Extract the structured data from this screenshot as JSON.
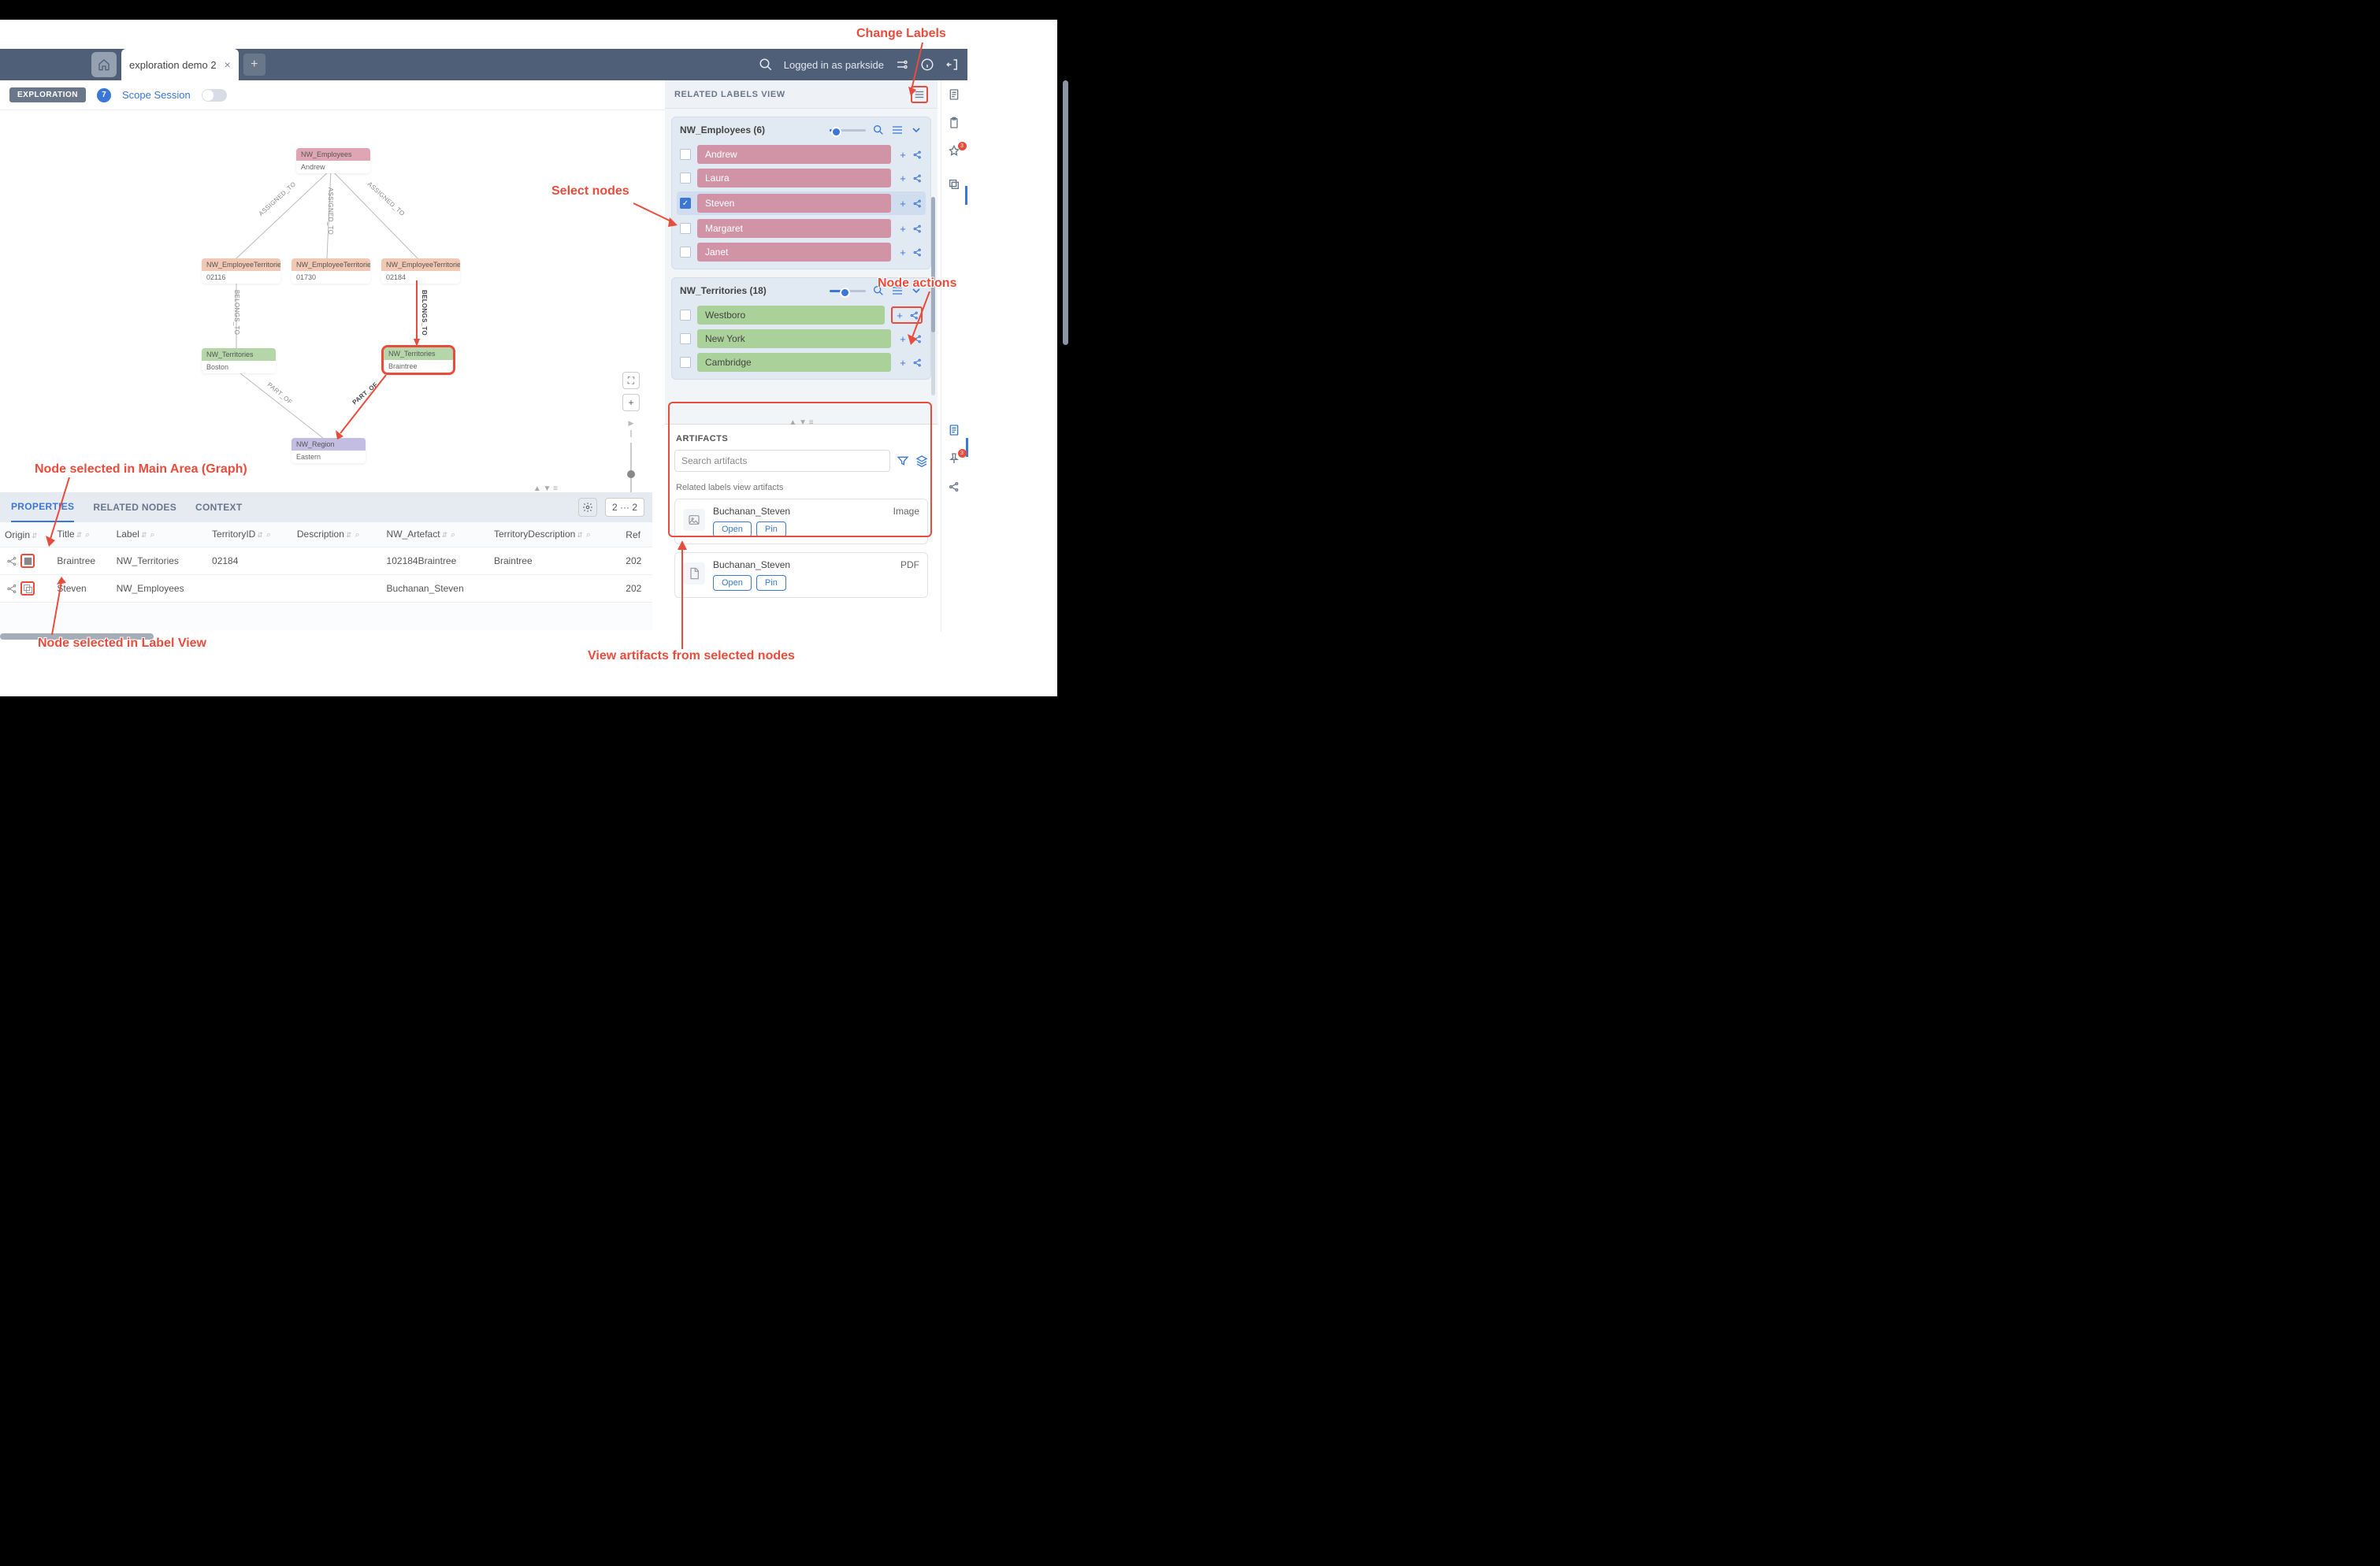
{
  "topbar": {
    "tab_name": "exploration demo 2",
    "login_text": "Logged in as parkside"
  },
  "secondbar": {
    "tag": "EXPLORATION",
    "count": "7",
    "scope": "Scope Session"
  },
  "graph": {
    "nodes": {
      "emp": {
        "label": "NW_Employees",
        "val": "Andrew"
      },
      "et1": {
        "label": "NW_EmployeeTerritories",
        "val": "02116"
      },
      "et2": {
        "label": "NW_EmployeeTerritories",
        "val": "01730"
      },
      "et3": {
        "label": "NW_EmployeeTerritories",
        "val": "02184"
      },
      "t1": {
        "label": "NW_Territories",
        "val": "Boston"
      },
      "t2": {
        "label": "NW_Territories",
        "val": "Braintree"
      },
      "reg": {
        "label": "NW_Region",
        "val": "Eastern"
      }
    },
    "edges": {
      "a1": "ASSIGNED_TO",
      "a2": "ASSIGNED_TO",
      "a3": "ASSIGNED_TO",
      "b1": "BELONGS_TO",
      "b2": "BELONGS_TO",
      "p1": "PART_OF",
      "p2": "PART_OF"
    }
  },
  "bottom": {
    "tabs": {
      "properties": "PROPERTIES",
      "related": "RELATED NODES",
      "context": "CONTEXT"
    },
    "pager": "2  ···  2",
    "headers": {
      "origin": "Origin",
      "title": "Title",
      "label": "Label",
      "terrid": "TerritoryID",
      "desc": "Description",
      "artefact": "NW_Artefact",
      "terrdesc": "TerritoryDescription",
      "ref": "Ref"
    },
    "rows": [
      {
        "title": "Braintree",
        "label": "NW_Territories",
        "terrid": "02184",
        "desc": "",
        "artefact": "102184Braintree",
        "terrdesc": "Braintree",
        "ref": "202"
      },
      {
        "title": "Steven",
        "label": "NW_Employees",
        "terrid": "",
        "desc": "",
        "artefact": "Buchanan_Steven",
        "terrdesc": "",
        "ref": "202"
      }
    ]
  },
  "related_labels": {
    "title": "RELATED LABELS VIEW",
    "groups": [
      {
        "name": "NW_Employees (6)",
        "items": [
          "Andrew",
          "Laura",
          "Steven",
          "Margaret",
          "Janet"
        ],
        "selected": [
          false,
          false,
          true,
          false,
          false
        ],
        "slider": "v1"
      },
      {
        "name": "NW_Territories (18)",
        "items": [
          "Westboro",
          "New York",
          "Cambridge"
        ],
        "selected": [
          false,
          false,
          false
        ],
        "slider": "v2"
      }
    ]
  },
  "artifacts": {
    "title": "ARTIFACTS",
    "search_placeholder": "Search artifacts",
    "section": "Related labels view artifacts",
    "items": [
      {
        "name": "Buchanan_Steven",
        "type": "Image",
        "open": "Open",
        "pin": "Pin"
      },
      {
        "name": "Buchanan_Steven",
        "type": "PDF",
        "open": "Open",
        "pin": "Pin"
      }
    ]
  },
  "rail": {
    "pin_badge": "3",
    "pin_badge2": "3"
  },
  "annotations": {
    "change_labels": "Change Labels",
    "select_nodes": "Select nodes",
    "node_actions": "Node actions",
    "node_main": "Node selected in Main Area (Graph)",
    "node_label": "Node selected in Label View",
    "view_artifacts": "View artifacts from selected nodes"
  }
}
